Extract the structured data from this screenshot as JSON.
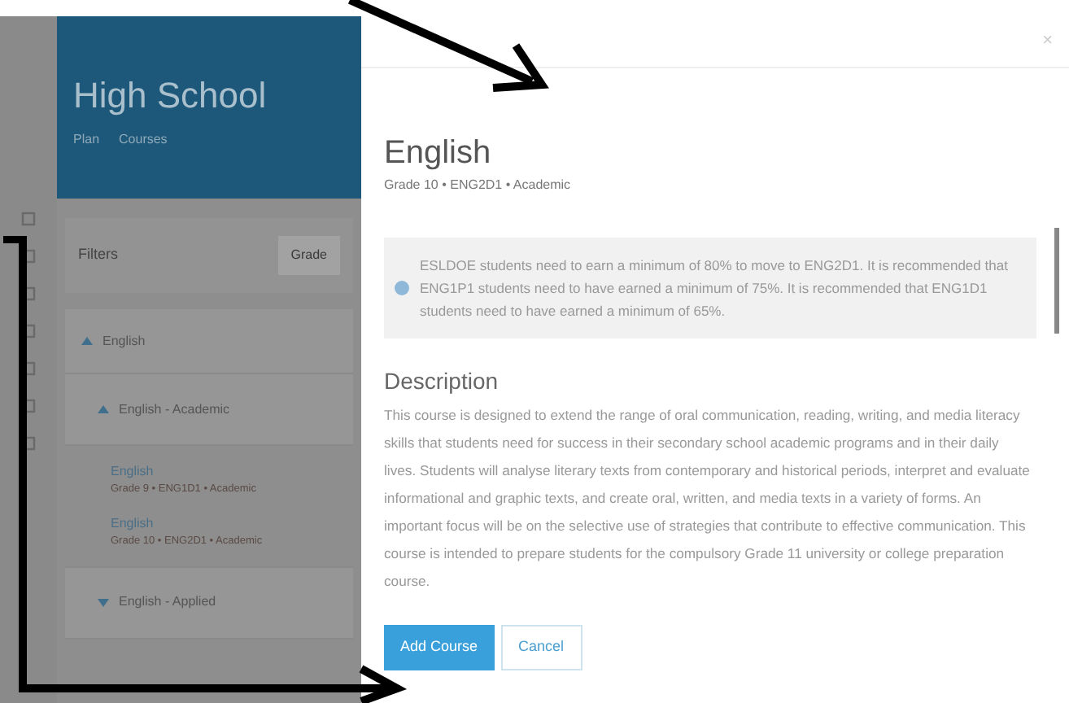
{
  "header": {
    "title": "High School",
    "nav": [
      "Plan",
      "Courses"
    ]
  },
  "filters": {
    "label": "Filters",
    "select": "Grade"
  },
  "tree": [
    {
      "label": "English",
      "expanded": true,
      "children": [
        {
          "label": "English - Academic",
          "expanded": true,
          "courses": [
            {
              "name": "English",
              "meta": "Grade 9 • ENG1D1 • Academic"
            },
            {
              "name": "English",
              "meta": "Grade 10 • ENG2D1 • Academic"
            }
          ]
        },
        {
          "label": "English - Applied",
          "expanded": false
        }
      ]
    }
  ],
  "modal": {
    "close": "×",
    "title": "English",
    "subtitle": "Grade 10 • ENG2D1 • Academic",
    "info": "ESLDOE students need to earn a minimum of 80% to move to ENG2D1. It is recommended that ENG1P1 students need to have earned a minimum of 75%. It is recommended that ENG1D1 students need to have earned a minimum of 65%.",
    "description_title": "Description",
    "description": "This course is designed to extend the range of oral communication, reading, writing, and media literacy skills that students need for success in their secondary school academic programs and in their daily lives. Students will analyse literary texts from contemporary and historical periods, interpret and evaluate informational and graphic texts, and create oral, written, and media texts in a variety of forms. An important focus will be on the selective use of strategies that contribute to effective communication. This course is intended to prepare students for the compulsory Grade 11 university or college preparation course.",
    "buttons": [
      {
        "label": "Add Course",
        "kind": "primary"
      },
      {
        "label": "Cancel",
        "kind": "secondary"
      }
    ]
  }
}
